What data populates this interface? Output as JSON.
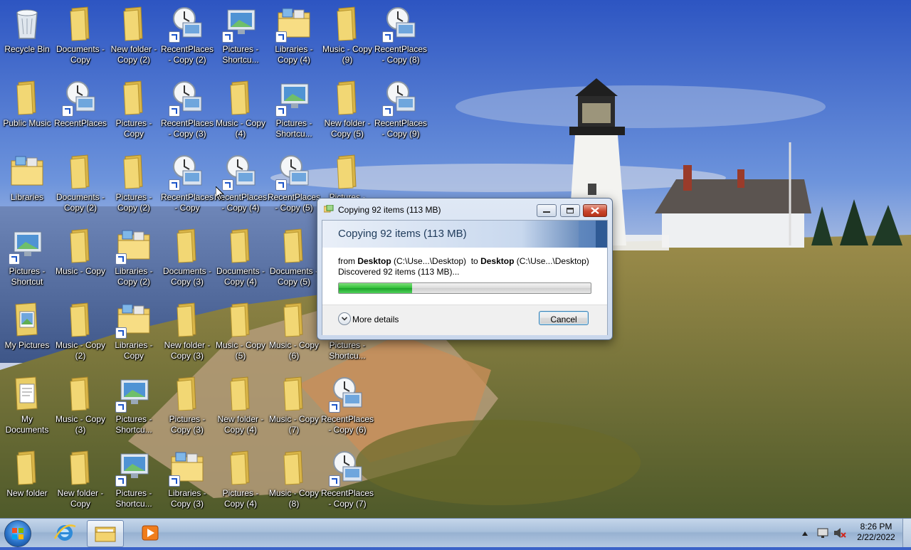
{
  "desktop": {
    "icons": [
      {
        "label": "Recycle Bin",
        "type": "bin"
      },
      {
        "label": "Documents - Copy",
        "type": "folder"
      },
      {
        "label": "New folder - Copy (2)",
        "type": "folder"
      },
      {
        "label": "RecentPlaces - Copy (2)",
        "type": "recent"
      },
      {
        "label": "Pictures - Shortcu...",
        "type": "monitor"
      },
      {
        "label": "Libraries - Copy (4)",
        "type": "library"
      },
      {
        "label": "Music - Copy (9)",
        "type": "folder"
      },
      {
        "label": "RecentPlaces - Copy (8)",
        "type": "recent"
      },
      {
        "label": "Public Music",
        "type": "folder"
      },
      {
        "label": "RecentPlaces",
        "type": "recent"
      },
      {
        "label": "Pictures - Copy",
        "type": "folder"
      },
      {
        "label": "RecentPlaces - Copy (3)",
        "type": "recent"
      },
      {
        "label": "Music - Copy (4)",
        "type": "folder"
      },
      {
        "label": "Pictures - Shortcu...",
        "type": "monitor"
      },
      {
        "label": "New folder - Copy (5)",
        "type": "folder"
      },
      {
        "label": "RecentPlaces - Copy (9)",
        "type": "recent"
      },
      {
        "label": "Libraries",
        "type": "library"
      },
      {
        "label": "Documents - Copy (2)",
        "type": "folder"
      },
      {
        "label": "Pictures - Copy (2)",
        "type": "folder"
      },
      {
        "label": "RecentPlaces - Copy",
        "type": "recent"
      },
      {
        "label": "RecentPlaces - Copy (4)",
        "type": "recent"
      },
      {
        "label": "RecentPlaces - Copy (5)",
        "type": "recent"
      },
      {
        "label": "Pictures -",
        "type": "folder"
      },
      {
        "label": "Pictures - Shortcut",
        "type": "monitor"
      },
      {
        "label": "Music - Copy",
        "type": "folder"
      },
      {
        "label": "Libraries - Copy (2)",
        "type": "library"
      },
      {
        "label": "Documents - Copy (3)",
        "type": "folder"
      },
      {
        "label": "Documents - Copy (4)",
        "type": "folder"
      },
      {
        "label": "Documents - Copy (5)",
        "type": "folder"
      },
      {
        "label": "My Pictures",
        "type": "mypictures"
      },
      {
        "label": "Music - Copy (2)",
        "type": "folder"
      },
      {
        "label": "Libraries - Copy",
        "type": "library"
      },
      {
        "label": "New folder - Copy (3)",
        "type": "folder"
      },
      {
        "label": "Music - Copy (5)",
        "type": "folder"
      },
      {
        "label": "Music - Copy (6)",
        "type": "folder"
      },
      {
        "label": "Pictures - Shortcu...",
        "type": "none"
      },
      {
        "label": "My Documents",
        "type": "mydocs"
      },
      {
        "label": "Music - Copy (3)",
        "type": "folder"
      },
      {
        "label": "Pictures - Shortcu...",
        "type": "monitor"
      },
      {
        "label": "Pictures - Copy (3)",
        "type": "folder"
      },
      {
        "label": "New folder - Copy (4)",
        "type": "folder"
      },
      {
        "label": "Music - Copy (7)",
        "type": "folder"
      },
      {
        "label": "RecentPlaces - Copy (6)",
        "type": "recent"
      },
      {
        "label": "New folder",
        "type": "folder"
      },
      {
        "label": "New folder - Copy",
        "type": "folder"
      },
      {
        "label": "Pictures - Shortcu...",
        "type": "monitor"
      },
      {
        "label": "Libraries - Copy (3)",
        "type": "library"
      },
      {
        "label": "Pictures - Copy (4)",
        "type": "folder"
      },
      {
        "label": "Music - Copy (8)",
        "type": "folder"
      },
      {
        "label": "RecentPlaces - Copy (7)",
        "type": "recent"
      }
    ]
  },
  "dialog": {
    "title": "Copying 92 items (113 MB)",
    "header": "Copying 92 items (113 MB)",
    "from_word": "from ",
    "from_name": "Desktop",
    "from_path": " (C:\\Use...\\Desktop)",
    "to_word": "  to ",
    "to_name": "Desktop",
    "to_path": " (C:\\Use...\\Desktop)",
    "discovered": "Discovered 92 items (113 MB)...",
    "progress": 0.29,
    "more_details": "More details",
    "cancel": "Cancel"
  },
  "taskbar": {
    "time": "8:26 PM",
    "date": "2/22/2022"
  },
  "colors": {
    "progress_green": "#2fbf38",
    "title_accent": "#3e6aa6"
  }
}
